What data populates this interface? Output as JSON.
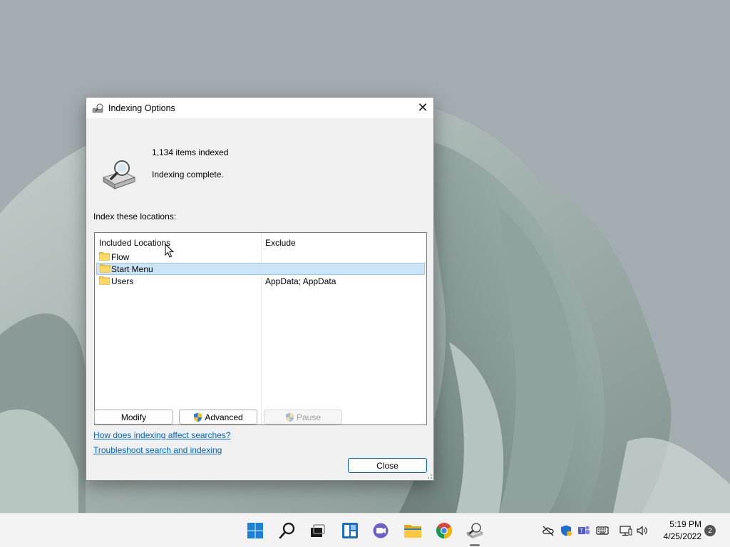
{
  "dialog": {
    "title": "Indexing Options",
    "items_indexed": "1,134 items indexed",
    "status": "Indexing complete.",
    "index_label": "Index these locations:",
    "columns": {
      "included": "Included Locations",
      "exclude": "Exclude"
    },
    "rows": [
      {
        "name": "Flow",
        "exclude": ""
      },
      {
        "name": "Start Menu",
        "exclude": "",
        "selected": true
      },
      {
        "name": "Users",
        "exclude": "AppData; AppData"
      }
    ],
    "buttons": {
      "modify": "Modify",
      "advanced": "Advanced",
      "pause": "Pause",
      "close": "Close"
    },
    "links": {
      "help": "How does indexing affect searches?",
      "troubleshoot": "Troubleshoot search and indexing"
    }
  },
  "taskbar": {
    "icons": [
      "start-icon",
      "search-icon",
      "task-view-icon",
      "widgets-icon",
      "chat-icon",
      "file-explorer-icon",
      "chrome-icon",
      "indexing-options-icon"
    ],
    "tray": [
      "onedrive-icon",
      "defender-icon",
      "teams-icon",
      "keyboard-icon",
      "network-icon",
      "volume-icon"
    ],
    "time": "5:19 PM",
    "date": "4/25/2022",
    "notifications": "2"
  },
  "colors": {
    "accent": "#0067c0",
    "selection": "#cce4f7",
    "link": "#0066cc"
  }
}
